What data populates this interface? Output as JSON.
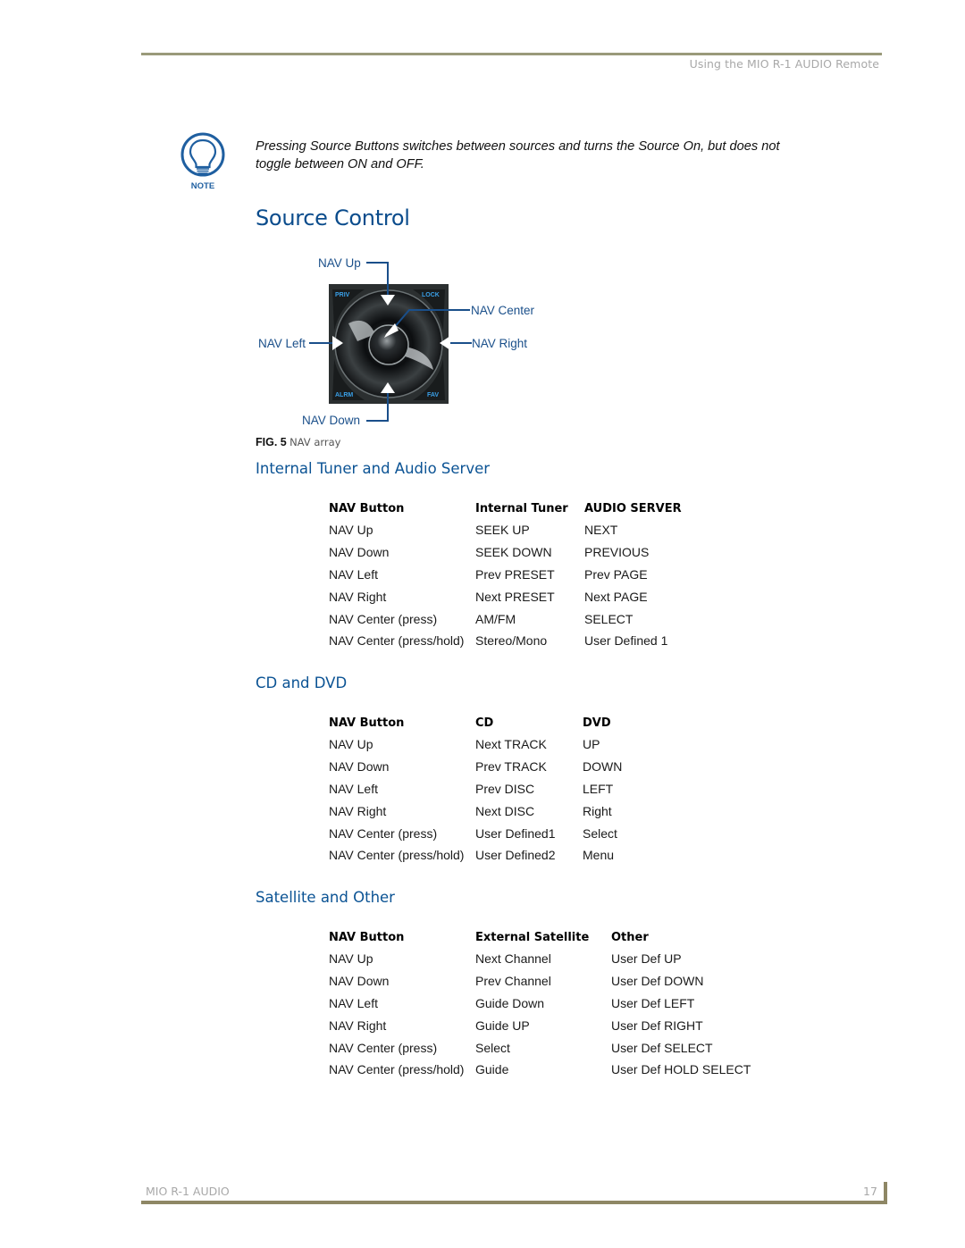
{
  "header": {
    "running_title": "Using the MIO R-1 AUDIO Remote"
  },
  "note": {
    "icon": "lightbulb-note-icon",
    "icon_label": "NOTE",
    "text": "Pressing Source Buttons switches between sources and turns the Source On, but does not toggle between ON and OFF."
  },
  "page_title": "Source Control",
  "figure": {
    "labels": {
      "up": "NAV Up",
      "center": "NAV Center",
      "left": "NAV Left",
      "right": "NAV Right",
      "down": "NAV Down"
    },
    "keypad_buttons": {
      "top_left": "PRIV",
      "top_right": "LOCK",
      "bottom_left": "ALRM",
      "bottom_right": "FAV"
    },
    "caption_number": "FIG. 5",
    "caption_text": "NAV array"
  },
  "sections": [
    {
      "heading": "Internal Tuner and Audio Server",
      "columns": [
        "NAV Button",
        "Internal Tuner",
        "AUDIO SERVER"
      ],
      "rows": [
        [
          "NAV Up",
          "SEEK UP",
          "NEXT"
        ],
        [
          "NAV Down",
          "SEEK DOWN",
          "PREVIOUS"
        ],
        [
          "NAV Left",
          "Prev PRESET",
          "Prev PAGE"
        ],
        [
          "NAV Right",
          "Next PRESET",
          "Next PAGE"
        ],
        [
          "NAV Center (press)",
          "AM/FM",
          "SELECT"
        ],
        [
          "NAV Center (press/hold)",
          "Stereo/Mono",
          "User Defined 1"
        ]
      ]
    },
    {
      "heading": "CD and DVD",
      "columns": [
        "NAV Button",
        "CD",
        "DVD"
      ],
      "rows": [
        [
          "NAV Up",
          "Next TRACK",
          "UP"
        ],
        [
          "NAV Down",
          "Prev TRACK",
          "DOWN"
        ],
        [
          "NAV Left",
          "Prev DISC",
          "LEFT"
        ],
        [
          "NAV Right",
          "Next DISC",
          "Right"
        ],
        [
          "NAV Center (press)",
          "User Defined1",
          "Select"
        ],
        [
          "NAV Center (press/hold)",
          "User Defined2",
          "Menu"
        ]
      ]
    },
    {
      "heading": "Satellite and Other",
      "columns": [
        "NAV Button",
        "External Satellite",
        "Other"
      ],
      "rows": [
        [
          "NAV Up",
          "Next Channel",
          "User Def UP"
        ],
        [
          "NAV Down",
          "Prev Channel",
          "User Def DOWN"
        ],
        [
          "NAV Left",
          "Guide Down",
          "User Def LEFT"
        ],
        [
          "NAV Right",
          "Guide UP",
          "User Def RIGHT"
        ],
        [
          "NAV Center (press)",
          "Select",
          "User Def SELECT"
        ],
        [
          "NAV Center (press/hold)",
          "Guide",
          "User Def HOLD SELECT"
        ]
      ]
    }
  ],
  "footer": {
    "product": "MIO R-1 AUDIO",
    "page_number": "17"
  },
  "colors": {
    "heading_blue": "#0b4c8c",
    "label_blue": "#1a4f8a",
    "rule_olive": "#8e8765",
    "header_gray": "#a8a8a8"
  }
}
